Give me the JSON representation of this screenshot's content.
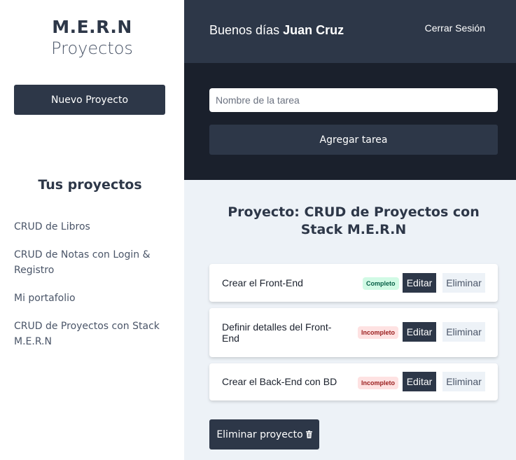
{
  "sidebar": {
    "logo_title": "M.E.R.N",
    "logo_subtitle": "Proyectos",
    "new_project_label": "Nuevo Proyecto",
    "projects_heading": "Tus proyectos",
    "projects": [
      "CRUD de Libros",
      "CRUD de Notas con Login & Registro",
      "Mi portafolio",
      "CRUD de Proyectos con Stack M.E.R.N"
    ]
  },
  "header": {
    "greeting_prefix": "Buenos días",
    "user_name": "Juan Cruz",
    "logout_label": "Cerrar Sesión"
  },
  "form": {
    "task_placeholder": "Nombre de la tarea",
    "task_value": "",
    "add_task_label": "Agregar tarea"
  },
  "main": {
    "project_title": "Proyecto: CRUD de Proyectos con Stack M.E.R.N",
    "tasks": [
      {
        "name": "Crear el Front-End",
        "status": "Completo",
        "edit_label": "Editar",
        "delete_label": "Eliminar"
      },
      {
        "name": "Definir detalles del Front-End",
        "status": "Incompleto",
        "edit_label": "Editar",
        "delete_label": "Eliminar"
      },
      {
        "name": "Crear el Back-End con BD",
        "status": "Incompleto",
        "edit_label": "Editar",
        "delete_label": "Eliminar"
      }
    ],
    "delete_project_label": "Eliminar proyecto",
    "delete_project_icon": "trash-icon"
  },
  "colors": {
    "primary": "#2d3748",
    "dark": "#1a202c",
    "background": "#edf2f7",
    "complete_badge": "#d1fae5",
    "incomplete_badge": "#fee2e2"
  }
}
